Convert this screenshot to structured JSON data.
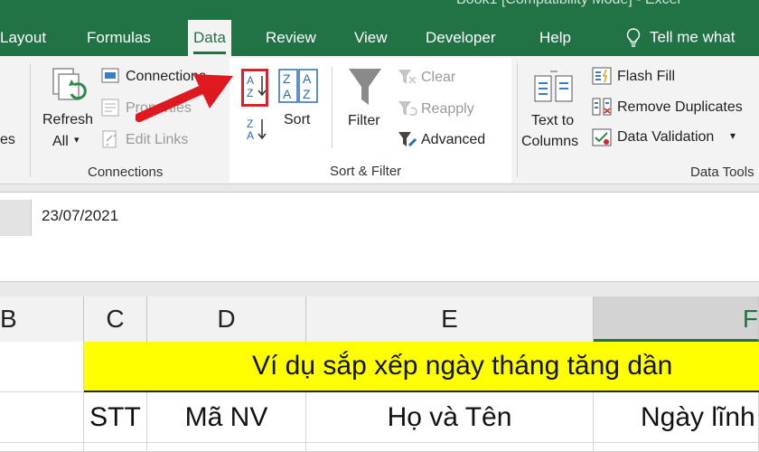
{
  "window": {
    "title": "Book1 [Compatibility Mode] - Excel"
  },
  "tabs": [
    {
      "label": "Layout"
    },
    {
      "label": "Formulas"
    },
    {
      "label": "Data",
      "active": true
    },
    {
      "label": "Review"
    },
    {
      "label": "View"
    },
    {
      "label": "Developer"
    },
    {
      "label": "Help"
    }
  ],
  "tell_me": "Tell me what",
  "ribbon": {
    "connections_group": {
      "partial_left_label": "es",
      "refresh_all_line1": "Refresh",
      "refresh_all_line2": "All",
      "connections": "Connections",
      "properties": "Properties",
      "edit_links": "Edit Links",
      "group_label": "Connections"
    },
    "sort_filter_group": {
      "sort_az_icon_top": "A",
      "sort_az_icon_bottom": "Z",
      "sort_za_icon_top": "Z",
      "sort_za_icon_bottom": "A",
      "sort_label": "Sort",
      "filter_label": "Filter",
      "clear": "Clear",
      "reapply": "Reapply",
      "advanced": "Advanced",
      "group_label": "Sort & Filter"
    },
    "data_tools_group": {
      "text_to_columns_line1": "Text to",
      "text_to_columns_line2": "Columns",
      "flash_fill": "Flash Fill",
      "remove_duplicates": "Remove Duplicates",
      "data_validation": "Data Validation",
      "group_label": "Data Tools"
    }
  },
  "formula_bar": {
    "value": "23/07/2021"
  },
  "columns": [
    "B",
    "C",
    "D",
    "E",
    "F"
  ],
  "sheet": {
    "title": "Ví dụ sắp xếp ngày tháng tăng dần",
    "headers": [
      "STT",
      "Mã NV",
      "Họ và Tên",
      "Ngày lĩnh"
    ]
  },
  "colors": {
    "excel_green": "#217346",
    "title_fill": "#ffff00",
    "highlight_red": "#d6232c"
  }
}
